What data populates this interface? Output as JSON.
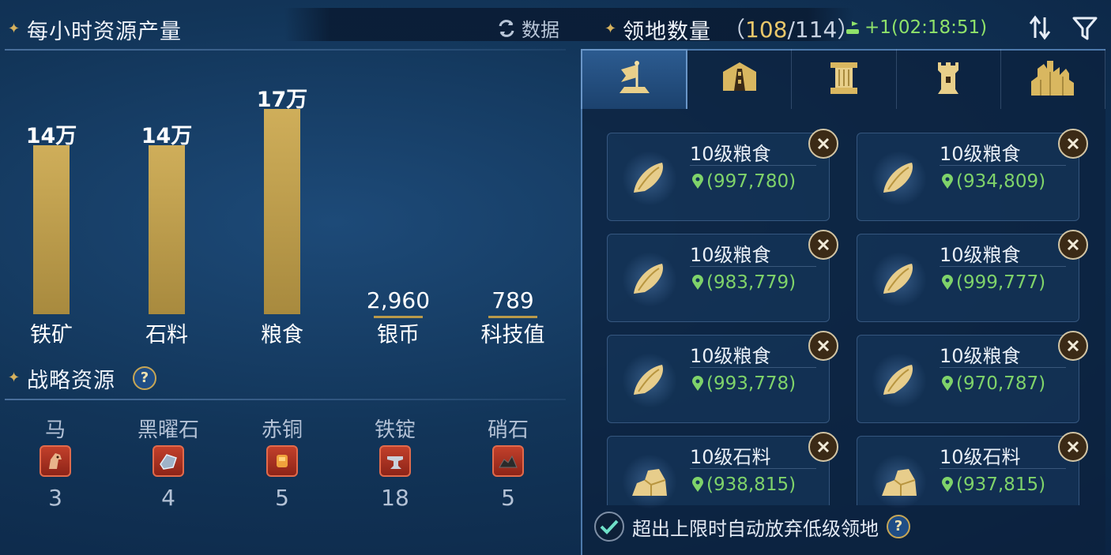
{
  "header": {
    "production_title": "每小时资源产量",
    "data_button": "数据",
    "territory_label": "领地数量",
    "territory_open": "（",
    "territory_current": "108",
    "territory_sep": "/",
    "territory_max": "114",
    "territory_close": "）",
    "gain_text": "+1(02:18:51)"
  },
  "chart_data": {
    "type": "bar",
    "categories": [
      "铁矿",
      "石料",
      "粮食"
    ],
    "values": [
      140000,
      140000,
      170000
    ],
    "value_labels": [
      "14万",
      "14万",
      "17万"
    ],
    "ylim": [
      0,
      170000
    ]
  },
  "flat_resources": [
    {
      "name": "银币",
      "value": "2,960"
    },
    {
      "name": "科技值",
      "value": "789"
    }
  ],
  "strategic": {
    "title": "战略资源",
    "help": "?",
    "items": [
      {
        "name": "马",
        "value": "3",
        "icon": "horse-icon"
      },
      {
        "name": "黑曜石",
        "value": "4",
        "icon": "obsidian-icon"
      },
      {
        "name": "赤铜",
        "value": "5",
        "icon": "copper-icon"
      },
      {
        "name": "铁锭",
        "value": "18",
        "icon": "iron-ingot-icon"
      },
      {
        "name": "硝石",
        "value": "5",
        "icon": "saltpeter-icon"
      }
    ]
  },
  "tabs": [
    {
      "icon": "flag-icon",
      "active": true
    },
    {
      "icon": "road-icon",
      "active": false
    },
    {
      "icon": "pillar-icon",
      "active": false
    },
    {
      "icon": "tower-icon",
      "active": false
    },
    {
      "icon": "city-icon",
      "active": false
    }
  ],
  "territories": [
    {
      "title": "10级粮食",
      "coord": "(997,780)",
      "kind": "grain"
    },
    {
      "title": "10级粮食",
      "coord": "(934,809)",
      "kind": "grain"
    },
    {
      "title": "10级粮食",
      "coord": "(983,779)",
      "kind": "grain"
    },
    {
      "title": "10级粮食",
      "coord": "(999,777)",
      "kind": "grain"
    },
    {
      "title": "10级粮食",
      "coord": "(993,778)",
      "kind": "grain"
    },
    {
      "title": "10级粮食",
      "coord": "(970,787)",
      "kind": "grain"
    },
    {
      "title": "10级石料",
      "coord": "(938,815)",
      "kind": "stone"
    },
    {
      "title": "10级石料",
      "coord": "(937,815)",
      "kind": "stone"
    }
  ],
  "footer": {
    "auto_abandon_label": "超出上限时自动放弃低级领地",
    "help": "?"
  },
  "colors": {
    "gold": "#cfae5a",
    "coord_green": "#7fd36a",
    "background": "#123559"
  }
}
